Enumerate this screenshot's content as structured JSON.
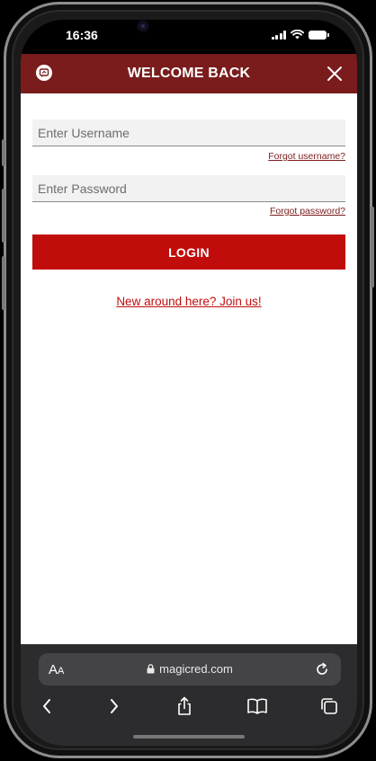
{
  "status_bar": {
    "time": "16:36"
  },
  "header": {
    "title": "WELCOME BACK"
  },
  "login_form": {
    "username_placeholder": "Enter Username",
    "username_value": "",
    "forgot_username": "Forgot username?",
    "password_placeholder": "Enter Password",
    "password_value": "",
    "forgot_password": "Forgot password?",
    "login_label": "LOGIN",
    "join_link": "New around here? Join us!"
  },
  "browser": {
    "text_size_label": "AA",
    "url": "magicred.com"
  },
  "icons": {
    "logo": "brand-logo-icon",
    "close": "close-icon",
    "lock": "lock-icon",
    "reload": "reload-icon",
    "back": "chevron-left-icon",
    "forward": "chevron-right-icon",
    "share": "share-icon",
    "bookmarks": "book-icon",
    "tabs": "tabs-icon"
  },
  "colors": {
    "header_bg": "#7a1c1c",
    "accent": "#c10c0c",
    "browser_bg": "#2c2c2e"
  }
}
